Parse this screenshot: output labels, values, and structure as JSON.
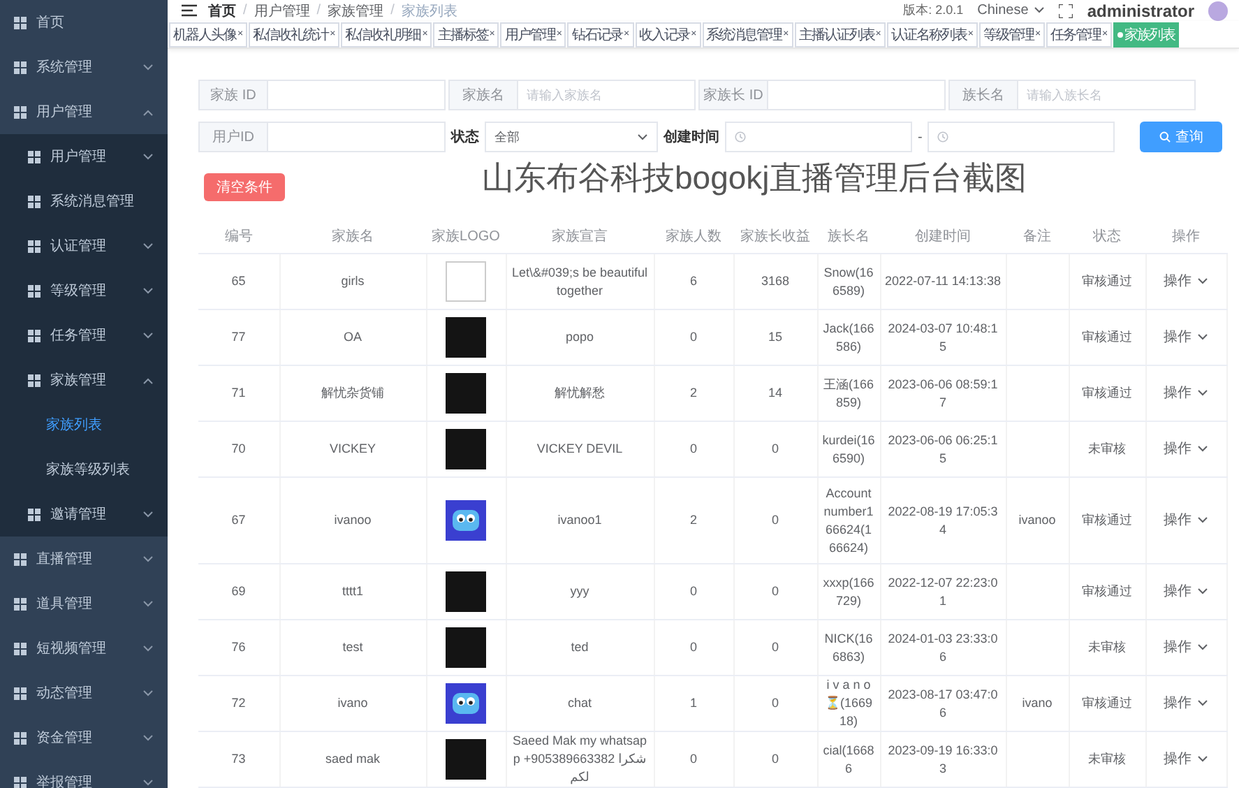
{
  "sidebar": {
    "items": [
      {
        "label": "首页",
        "selected": false
      },
      {
        "label": "系统管理",
        "selected": false,
        "expanded": false
      },
      {
        "label": "用户管理",
        "selected": false,
        "expanded": true,
        "children": [
          {
            "label": "用户管理",
            "selected": false,
            "expanded": false
          },
          {
            "label": "系统消息管理",
            "selected": false
          },
          {
            "label": "认证管理",
            "selected": false,
            "expanded": false
          },
          {
            "label": "等级管理",
            "selected": false,
            "expanded": false
          },
          {
            "label": "任务管理",
            "selected": false,
            "expanded": false
          },
          {
            "label": "家族管理",
            "selected": false,
            "expanded": true,
            "children": [
              {
                "label": "家族列表",
                "selected": true
              },
              {
                "label": "家族等级列表",
                "selected": false
              }
            ]
          },
          {
            "label": "邀请管理",
            "selected": false,
            "expanded": false
          }
        ]
      },
      {
        "label": "直播管理",
        "selected": false,
        "expanded": false
      },
      {
        "label": "道具管理",
        "selected": false,
        "expanded": false
      },
      {
        "label": "短视频管理",
        "selected": false,
        "expanded": false
      },
      {
        "label": "动态管理",
        "selected": false,
        "expanded": false
      },
      {
        "label": "资金管理",
        "selected": false,
        "expanded": false
      },
      {
        "label": "举报管理",
        "selected": false,
        "expanded": false
      }
    ]
  },
  "breadcrumb": {
    "separator": "/",
    "items": [
      "首页",
      "用户管理",
      "家族管理",
      "家族列表"
    ]
  },
  "header": {
    "version": "版本: 2.0.1",
    "language": "Chinese",
    "user": "administrator"
  },
  "tabs": [
    {
      "label": "机器人头像",
      "selected": false,
      "close": "×"
    },
    {
      "label": "私信收礼统计",
      "selected": false,
      "close": "×"
    },
    {
      "label": "私信收礼明细",
      "selected": false,
      "close": "×"
    },
    {
      "label": "主播标签",
      "selected": false,
      "close": "×"
    },
    {
      "label": "用户管理",
      "selected": false,
      "close": "×"
    },
    {
      "label": "钻石记录",
      "selected": false,
      "close": "×"
    },
    {
      "label": "收入记录",
      "selected": false,
      "close": "×"
    },
    {
      "label": "系统消息管理",
      "selected": false,
      "close": "×"
    },
    {
      "label": "主播认证列表",
      "selected": false,
      "close": "×"
    },
    {
      "label": "认证名称列表",
      "selected": false,
      "close": "×"
    },
    {
      "label": "等级管理",
      "selected": false,
      "close": "×"
    },
    {
      "label": "任务管理",
      "selected": false,
      "close": "×"
    },
    {
      "label": "家族列表",
      "selected": true
    }
  ],
  "filters": {
    "row_1": [
      {
        "label": "家族 ID"
      },
      {
        "label": "家族名",
        "placeholder": "请输入家族名"
      },
      {
        "label": "家族长 ID"
      },
      {
        "label": "族长名",
        "placeholder": "请输入族长名"
      }
    ],
    "user_id": {
      "label": "用户ID"
    },
    "status": {
      "label": "状态",
      "value": "全部"
    },
    "created": {
      "label": "创建时间",
      "separator": "-"
    },
    "search_button": "查询",
    "clear_button": "清空条件"
  },
  "caption": "山东布谷科技bogokj直播管理后台截图",
  "table": {
    "columns": [
      "编号",
      "家族名",
      "家族LOGO",
      "家族宣言",
      "家族人数",
      "家族长收益",
      "族长名",
      "创建时间",
      "备注",
      "状态",
      "操作"
    ],
    "rows": [
      {
        "id": "65",
        "name": "girls",
        "logo": {
          "kind": "broken"
        },
        "motto": "Let\\&#039;s be beautiful together",
        "members": "6",
        "income": "3168",
        "leader": "Snow(166589)",
        "created": "2022-07-11 14:13:38",
        "note": "",
        "status": "审核通过",
        "action": "操作"
      },
      {
        "id": "77",
        "name": "OA",
        "logo": {
          "kind": "photo"
        },
        "motto": "popo",
        "members": "0",
        "income": "15",
        "leader": "Jack(166586)",
        "created": "2024-03-07 10:48:15",
        "note": "",
        "status": "审核通过",
        "action": "操作"
      },
      {
        "id": "71",
        "name": "解忧杂货铺",
        "logo": {
          "kind": "photo"
        },
        "motto": "解忧解愁",
        "members": "2",
        "income": "14",
        "leader": "王涵(166859)",
        "created": "2023-06-06 08:59:17",
        "note": "",
        "status": "审核通过",
        "action": "操作"
      },
      {
        "id": "70",
        "name": "VICKEY",
        "logo": {
          "kind": "photo"
        },
        "motto": "VICKEY DEVIL",
        "members": "0",
        "income": "0",
        "leader": "kurdei(166590)",
        "created": "2023-06-06 06:25:15",
        "note": "",
        "status": "未审核",
        "action": "操作"
      },
      {
        "id": "67",
        "name": "ivanoo",
        "logo": {
          "kind": "app"
        },
        "motto": "ivanoo1",
        "members": "2",
        "income": "0",
        "leader": "Account number166624(166624)",
        "created": "2022-08-19 17:05:34",
        "note": "ivanoo",
        "status": "审核通过",
        "action": "操作"
      },
      {
        "id": "69",
        "name": "tttt1",
        "logo": {
          "kind": "photo"
        },
        "motto": "yyy",
        "members": "0",
        "income": "0",
        "leader": "xxxp(166729)",
        "created": "2022-12-07 22:23:01",
        "note": "",
        "status": "审核通过",
        "action": "操作"
      },
      {
        "id": "76",
        "name": "test",
        "logo": {
          "kind": "photo"
        },
        "motto": "ted",
        "members": "0",
        "income": "0",
        "leader": "NICK(166863)",
        "created": "2024-01-03 23:33:06",
        "note": "",
        "status": "未审核",
        "action": "操作"
      },
      {
        "id": "72",
        "name": "ivano",
        "logo": {
          "kind": "app"
        },
        "motto": "chat",
        "members": "1",
        "income": "0",
        "leader": "i v a n o ⏳(166918)",
        "created": "2023-08-17 03:47:06",
        "note": "ivano",
        "status": "审核通过",
        "action": "操作"
      },
      {
        "id": "73",
        "name": "saed mak",
        "logo": {
          "kind": "photo"
        },
        "motto": "Saeed Mak my whatsapp +905389663382 شكرا لكم",
        "members": "0",
        "income": "0",
        "leader": "cial(16686",
        "created": "2023-09-19 16:33:03",
        "note": "",
        "status": "未审核",
        "action": "操作"
      }
    ]
  }
}
